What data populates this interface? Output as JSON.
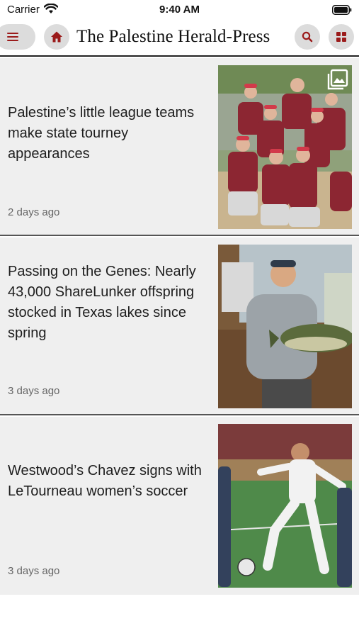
{
  "status_bar": {
    "carrier": "Carrier",
    "time": "9:40 AM",
    "icons": [
      "wifi-icon",
      "battery-icon"
    ]
  },
  "header": {
    "masthead": "The Palestine Herald-Press",
    "icons": [
      "menu-icon",
      "home-icon",
      "search-icon",
      "grid-icon"
    ],
    "accent_color": "#9b1b1b",
    "button_bg": "#dcdcdc"
  },
  "articles": [
    {
      "headline": "Palestine’s little league teams make state tourney appearances",
      "time_ago": "2 days ago",
      "has_gallery_icon": true
    },
    {
      "headline": "Passing on the Genes: Nearly 43,000 ShareLunker offspring stocked in Texas lakes since spring",
      "time_ago": "3 days ago",
      "has_gallery_icon": false
    },
    {
      "headline": "Westwood’s Chavez signs with LeTourneau women’s soccer",
      "time_ago": "3 days ago",
      "has_gallery_icon": false
    }
  ],
  "colors": {
    "card_bg": "#efefef",
    "divider": "#555555",
    "timestamp": "#666666"
  }
}
